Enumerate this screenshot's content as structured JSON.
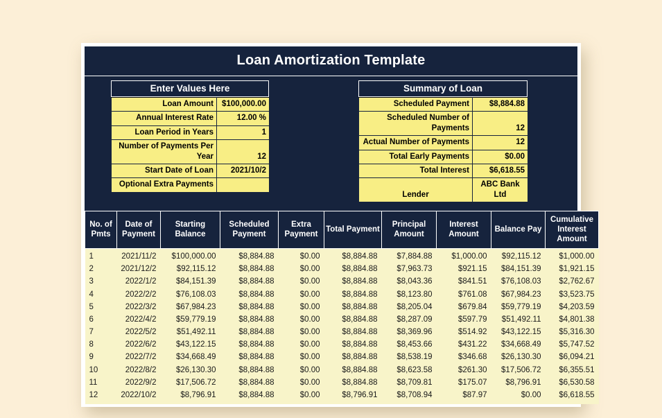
{
  "title": "Loan Amortization Template",
  "inputs": {
    "heading": "Enter Values Here",
    "rows": [
      {
        "label": "Loan Amount",
        "value": "$100,000.00"
      },
      {
        "label": "Annual Interest Rate",
        "value": "12.00 %"
      },
      {
        "label": "Loan Period in Years",
        "value": "1"
      },
      {
        "label": "Number of Payments Per Year",
        "value": "12"
      },
      {
        "label": "Start Date of Loan",
        "value": "2021/10/2"
      },
      {
        "label": "Optional Extra Payments",
        "value": ""
      }
    ]
  },
  "summary": {
    "heading": "Summary of Loan",
    "rows": [
      {
        "label": "Scheduled Payment",
        "value": "$8,884.88"
      },
      {
        "label": "Scheduled Number of Payments",
        "value": "12"
      },
      {
        "label": "Actual Number of Payments",
        "value": "12"
      },
      {
        "label": "Total Early Payments",
        "value": "$0.00"
      },
      {
        "label": "Total Interest",
        "value": "$6,618.55"
      }
    ],
    "lender_label": "Lender",
    "lender_value": "ABC Bank Ltd"
  },
  "table": {
    "headers": [
      "No. of Pmts",
      "Date of Payment",
      "Starting Balance",
      "Scheduled Payment",
      "Extra Payment",
      "Total Payment",
      "Principal Amount",
      "Interest Amount",
      "Balance Pay",
      "Cumulative Interest Amount"
    ],
    "rows": [
      [
        "1",
        "2021/11/2",
        "$100,000.00",
        "$8,884.88",
        "$0.00",
        "$8,884.88",
        "$7,884.88",
        "$1,000.00",
        "$92,115.12",
        "$1,000.00"
      ],
      [
        "2",
        "2021/12/2",
        "$92,115.12",
        "$8,884.88",
        "$0.00",
        "$8,884.88",
        "$7,963.73",
        "$921.15",
        "$84,151.39",
        "$1,921.15"
      ],
      [
        "3",
        "2022/1/2",
        "$84,151.39",
        "$8,884.88",
        "$0.00",
        "$8,884.88",
        "$8,043.36",
        "$841.51",
        "$76,108.03",
        "$2,762.67"
      ],
      [
        "4",
        "2022/2/2",
        "$76,108.03",
        "$8,884.88",
        "$0.00",
        "$8,884.88",
        "$8,123.80",
        "$761.08",
        "$67,984.23",
        "$3,523.75"
      ],
      [
        "5",
        "2022/3/2",
        "$67,984.23",
        "$8,884.88",
        "$0.00",
        "$8,884.88",
        "$8,205.04",
        "$679.84",
        "$59,779.19",
        "$4,203.59"
      ],
      [
        "6",
        "2022/4/2",
        "$59,779.19",
        "$8,884.88",
        "$0.00",
        "$8,884.88",
        "$8,287.09",
        "$597.79",
        "$51,492.11",
        "$4,801.38"
      ],
      [
        "7",
        "2022/5/2",
        "$51,492.11",
        "$8,884.88",
        "$0.00",
        "$8,884.88",
        "$8,369.96",
        "$514.92",
        "$43,122.15",
        "$5,316.30"
      ],
      [
        "8",
        "2022/6/2",
        "$43,122.15",
        "$8,884.88",
        "$0.00",
        "$8,884.88",
        "$8,453.66",
        "$431.22",
        "$34,668.49",
        "$5,747.52"
      ],
      [
        "9",
        "2022/7/2",
        "$34,668.49",
        "$8,884.88",
        "$0.00",
        "$8,884.88",
        "$8,538.19",
        "$346.68",
        "$26,130.30",
        "$6,094.21"
      ],
      [
        "10",
        "2022/8/2",
        "$26,130.30",
        "$8,884.88",
        "$0.00",
        "$8,884.88",
        "$8,623.58",
        "$261.30",
        "$17,506.72",
        "$6,355.51"
      ],
      [
        "11",
        "2022/9/2",
        "$17,506.72",
        "$8,884.88",
        "$0.00",
        "$8,884.88",
        "$8,709.81",
        "$175.07",
        "$8,796.91",
        "$6,530.58"
      ],
      [
        "12",
        "2022/10/2",
        "$8,796.91",
        "$8,884.88",
        "$0.00",
        "$8,796.91",
        "$8,708.94",
        "$87.97",
        "$0.00",
        "$6,618.55"
      ]
    ]
  },
  "colors": {
    "navy": "#16233d",
    "input_yellow": "#f8ee85",
    "table_yellow": "#f8f4c9",
    "page_background": "#fcefd7"
  }
}
